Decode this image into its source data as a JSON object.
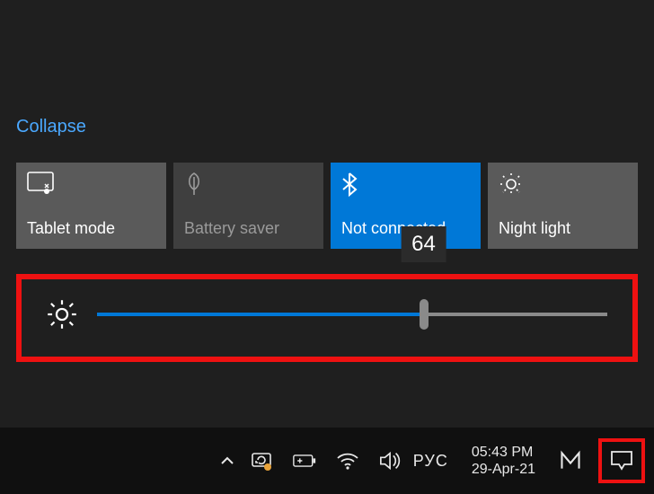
{
  "panel": {
    "collapse_label": "Collapse",
    "tiles": [
      {
        "label": "Tablet mode",
        "icon": "tablet",
        "state": "normal"
      },
      {
        "label": "Battery saver",
        "icon": "leaf",
        "state": "disabled"
      },
      {
        "label": "Not connected",
        "icon": "bluetooth",
        "state": "active"
      },
      {
        "label": "Night light",
        "icon": "nightlight",
        "state": "normal"
      }
    ],
    "brightness": {
      "value": 64,
      "min": 0,
      "max": 100
    }
  },
  "taskbar": {
    "overflow_icon": "chevron-up",
    "tray": [
      {
        "name": "sync-icon",
        "glyph": "sync"
      },
      {
        "name": "battery-icon",
        "glyph": "battery"
      },
      {
        "name": "wifi-icon",
        "glyph": "wifi"
      },
      {
        "name": "volume-icon",
        "glyph": "volume"
      }
    ],
    "language": "РУС",
    "clock": {
      "time": "05:43 PM",
      "date": "29-Apr-21"
    },
    "extra_icon": "monogram",
    "action_center_icon": "notification"
  },
  "highlight_color": "#e11"
}
